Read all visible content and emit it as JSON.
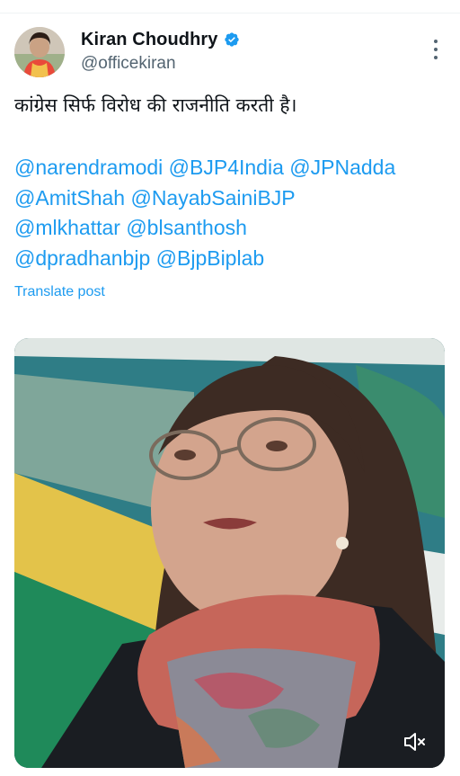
{
  "author": {
    "display_name": "Kiran Choudhry",
    "handle": "@officekiran",
    "verified": true,
    "verified_color": "#1d9bf0"
  },
  "tweet": {
    "text": "कांग्रेस सिर्फ विरोध की राजनीति करती है।",
    "mentions": [
      [
        "@narendramodi",
        "@BJP4India",
        "@JPNadda"
      ],
      [
        "@AmitShah",
        "@NayabSainiBJP"
      ],
      [
        "@mlkhattar",
        "@blsanthosh"
      ],
      [
        "@dpradhanbjp",
        "@BjpBiplab"
      ]
    ],
    "translate_label": "Translate post"
  },
  "media": {
    "type": "video",
    "muted": true,
    "icon": "volume-muted-icon"
  },
  "icons": {
    "more": "more-options-icon",
    "verified": "verified-badge-icon"
  },
  "colors": {
    "link": "#1d9bf0",
    "text": "#0f1419",
    "secondary": "#536471"
  }
}
